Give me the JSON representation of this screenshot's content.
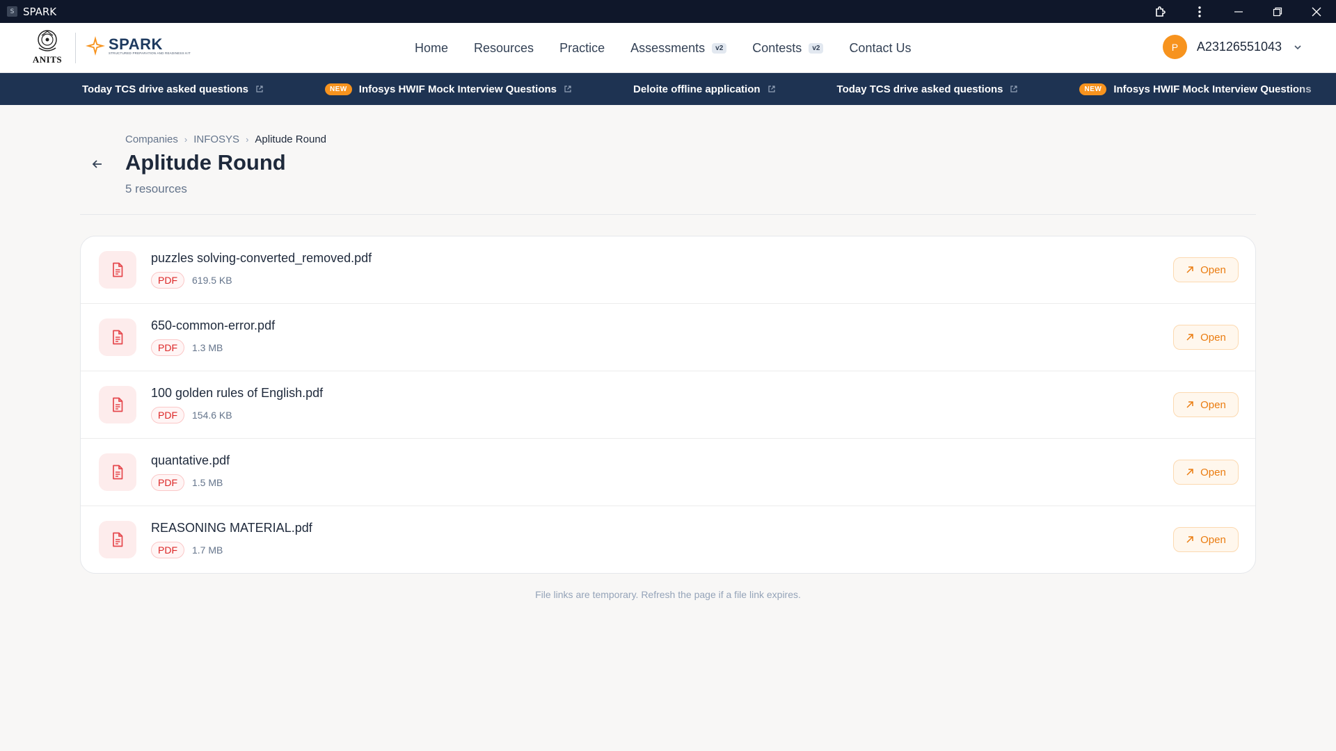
{
  "window": {
    "title": "SPARK",
    "app_icon_letter": "S"
  },
  "header": {
    "logo_text": "ANITS",
    "brand": "SPARK",
    "brand_tagline": "Structured Preparation and Readiness Kit",
    "nav": [
      {
        "label": "Home",
        "badge": null
      },
      {
        "label": "Resources",
        "badge": null
      },
      {
        "label": "Practice",
        "badge": null
      },
      {
        "label": "Assessments",
        "badge": "v2"
      },
      {
        "label": "Contests",
        "badge": "v2"
      },
      {
        "label": "Contact Us",
        "badge": null
      }
    ],
    "user": {
      "avatar_letter": "P",
      "id": "A23126551043"
    }
  },
  "ticker": {
    "new_label": "NEW",
    "items": [
      {
        "text": "Today TCS drive asked questions",
        "is_new": false
      },
      {
        "text": "Infosys HWIF Mock Interview Questions",
        "is_new": true
      },
      {
        "text": "Deloite offline application",
        "is_new": false
      },
      {
        "text": "Today TCS drive asked questions",
        "is_new": false
      },
      {
        "text": "Infosys HWIF Mock Interview Questions",
        "is_new": true
      }
    ]
  },
  "page": {
    "breadcrumb": [
      "Companies",
      "INFOSYS",
      "Aplitude Round"
    ],
    "title": "Aplitude Round",
    "subtitle": "5 resources",
    "footnote": "File links are temporary. Refresh the page if a file link expires.",
    "open_label": "Open",
    "files": [
      {
        "name": "puzzles solving-converted_removed.pdf",
        "type": "PDF",
        "size": "619.5 KB"
      },
      {
        "name": "650-common-error.pdf",
        "type": "PDF",
        "size": "1.3 MB"
      },
      {
        "name": "100 golden rules of English.pdf",
        "type": "PDF",
        "size": "154.6 KB"
      },
      {
        "name": "quantative.pdf",
        "type": "PDF",
        "size": "1.5 MB"
      },
      {
        "name": "REASONING MATERIAL.pdf",
        "type": "PDF",
        "size": "1.7 MB"
      }
    ]
  },
  "colors": {
    "accent": "#f7931e",
    "navy": "#1e3352",
    "pdf_red": "#dc2626"
  }
}
